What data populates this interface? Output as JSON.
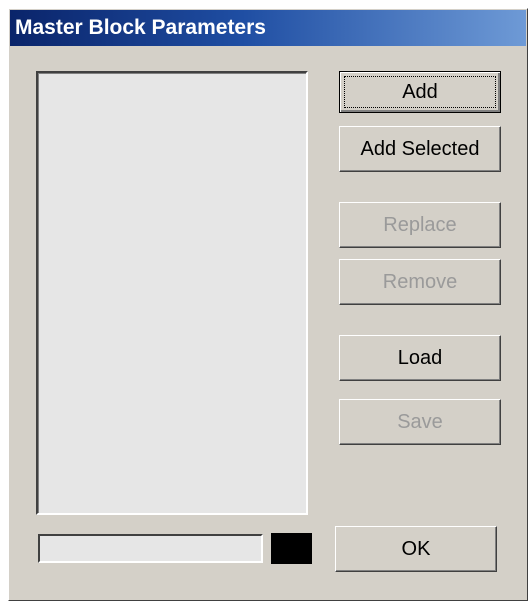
{
  "window": {
    "title": "Master Block Parameters"
  },
  "buttons": {
    "add": {
      "label": "Add",
      "enabled": true,
      "default": true
    },
    "add_selected": {
      "label": "Add Selected",
      "enabled": true
    },
    "replace": {
      "label": "Replace",
      "enabled": false
    },
    "remove": {
      "label": "Remove",
      "enabled": false
    },
    "load": {
      "label": "Load",
      "enabled": true
    },
    "save": {
      "label": "Save",
      "enabled": false
    },
    "ok": {
      "label": "OK",
      "enabled": true
    }
  },
  "list": {
    "items": []
  },
  "progress": {
    "value": 0
  },
  "colors": {
    "dialog_bg": "#d4d0c8",
    "title_gradient_start": "#0a246a",
    "title_gradient_end": "#6e9ad6",
    "list_bg": "#e6e6e6",
    "color_swatch": "#000000",
    "disabled_text": "#9a9a9a"
  }
}
